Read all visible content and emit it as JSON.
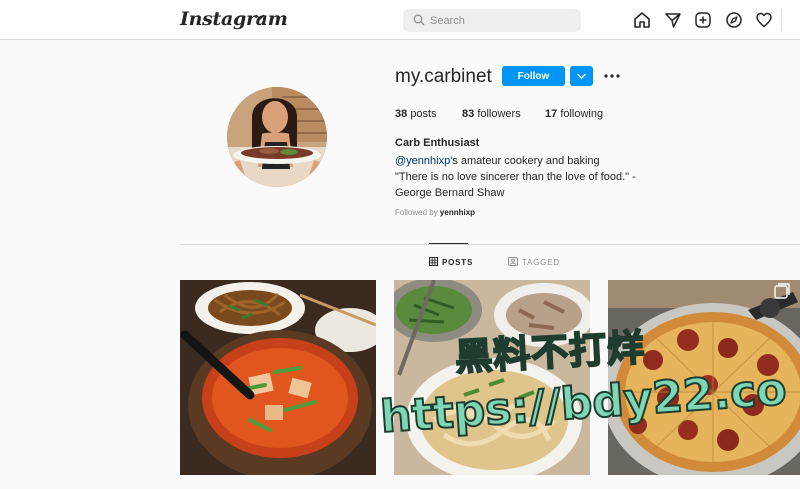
{
  "nav": {
    "logo_text": "Instagram",
    "search_placeholder": "Search",
    "icons": [
      "home-icon",
      "direct-message-icon",
      "new-post-icon",
      "explore-icon",
      "activity-heart-icon"
    ]
  },
  "profile": {
    "username": "my.carbinet",
    "follow_label": "Follow",
    "stats": {
      "posts_count": "38",
      "posts_label": "posts",
      "followers_count": "83",
      "followers_label": "followers",
      "following_count": "17",
      "following_label": "following"
    },
    "full_name": "Carb Enthusiast",
    "bio_mention": "@yennhixp",
    "bio_line1_rest": "'s amateur cookery and baking",
    "bio_line2": "\"There is no love sincerer than the love of food.\" -",
    "bio_line3": "George Bernard Shaw",
    "followed_by_prefix": "Followed by",
    "followed_by_user": "yennhixp"
  },
  "tabs": [
    {
      "label": "POSTS",
      "active": true
    },
    {
      "label": "TAGGED",
      "active": false
    }
  ],
  "posts": [
    {
      "subject": "kimchi stew with japchae noodles"
    },
    {
      "subject": "noodle soup with herbs"
    },
    {
      "subject": "pepperoni pizza",
      "badge": "multiple-images-icon"
    }
  ],
  "watermark": {
    "line1": "黑料不打烊",
    "line2": "https://bdy22.co"
  },
  "colors": {
    "accent": "#0095f6",
    "background": "#fafafa",
    "text": "#262626",
    "muted": "#8e8e8e",
    "mention": "#00376b"
  }
}
